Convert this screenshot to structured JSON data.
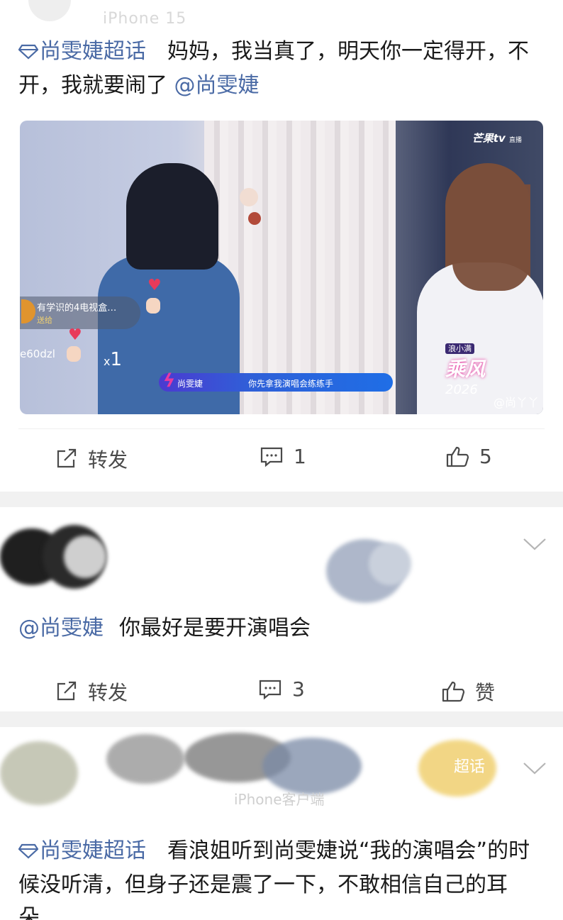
{
  "post1": {
    "header_faded": "iPhone 15",
    "topic_label": "尚雯婕超话",
    "body_text": "妈妈，我当真了，明天你一定得开，不开，我就要闹了",
    "mention": "@尚雯婕",
    "video": {
      "brand": "芒果tv",
      "brand_sub": "直播",
      "gift_user": "有学识的4电视盒…",
      "gift_sub": "送给",
      "user2": "e60dzl",
      "combo_prefix": "x",
      "combo_count": "1",
      "subtitle_name": "尚雯婕",
      "subtitle_text": "你先拿我演唱会练练手",
      "show_tag": "浪小满",
      "show_title": "乘风",
      "show_year": "2026",
      "watermark": "@尚丫丫"
    },
    "actions": {
      "repost": "转发",
      "comments": "1",
      "likes": "5"
    }
  },
  "post2": {
    "mention": "@尚雯婕",
    "body_text": "你最好是要开演唱会",
    "actions": {
      "repost": "转发",
      "comments": "3",
      "likes": "赞"
    }
  },
  "post3": {
    "faded_meta": "iPhone客户端",
    "faded_badge": "超话",
    "topic_label": "尚雯婕超话",
    "body_text": "看浪姐听到尚雯婕说“我的演唱会”的时候没听清，但身子还是震了一下，不敢相信自己的耳朵…"
  },
  "colors": {
    "link": "#4a6aa5",
    "separator": "#f1f1f1",
    "icon": "#4a4a4a"
  },
  "icons": [
    "diamond-icon",
    "repost-icon",
    "comment-icon",
    "like-icon",
    "chevron-down-icon"
  ]
}
